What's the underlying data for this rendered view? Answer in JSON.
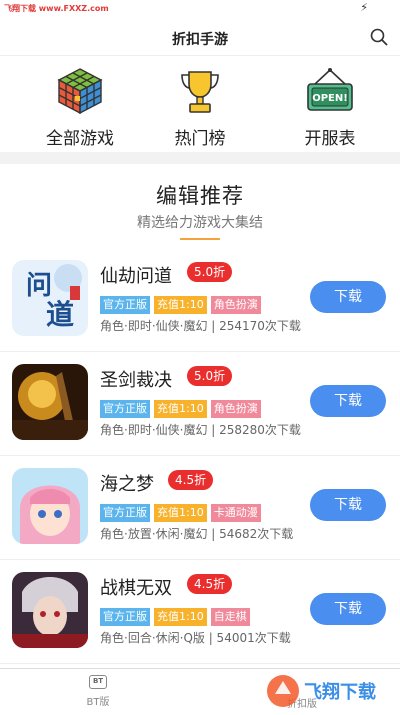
{
  "status_bar": {
    "watermark": "飞翔下载 www.FXXZ.com"
  },
  "header": {
    "title": "折扣手游",
    "search_icon": "search-icon"
  },
  "quick_links": [
    {
      "label": "全部游戏",
      "icon": "cube-icon"
    },
    {
      "label": "热门榜",
      "icon": "trophy-icon"
    },
    {
      "label": "开服表",
      "icon": "open-sign-icon"
    }
  ],
  "section": {
    "title": "编辑推荐",
    "subtitle": "精选给力游戏大集结",
    "accent": "#f5a23c"
  },
  "games": [
    {
      "name": "仙劫问道",
      "discount": "5.0折",
      "tags": [
        "官方正版",
        "充值1:10",
        "角色扮演"
      ],
      "meta": "角色·即时·仙侠·魔幻 | 254170次下载",
      "button": "下载"
    },
    {
      "name": "圣剑裁决",
      "discount": "5.0折",
      "tags": [
        "官方正版",
        "充值1:10",
        "角色扮演"
      ],
      "meta": "角色·即时·仙侠·魔幻 | 258280次下载",
      "button": "下载"
    },
    {
      "name": "海之梦",
      "discount": "4.5折",
      "tags": [
        "官方正版",
        "充值1:10",
        "卡通动漫"
      ],
      "meta": "角色·放置·休闲·魔幻 | 54682次下载",
      "button": "下载"
    },
    {
      "name": "战棋无双",
      "discount": "4.5折",
      "tags": [
        "官方正版",
        "充值1:10",
        "自走棋"
      ],
      "meta": "角色·回合·休闲·Q版 | 54001次下载",
      "button": "下载"
    }
  ],
  "tab_bar": [
    {
      "label": "BT版",
      "icon_text": "BT"
    },
    {
      "label": "折扣版"
    }
  ],
  "colors": {
    "discount": "#ea2e2e",
    "download": "#4a8ff0",
    "tag_blue": "#5bb4ec",
    "tag_orange": "#f7b12a",
    "tag_pink": "#f08a9b"
  },
  "watermark_bottom": "飞翔下载"
}
